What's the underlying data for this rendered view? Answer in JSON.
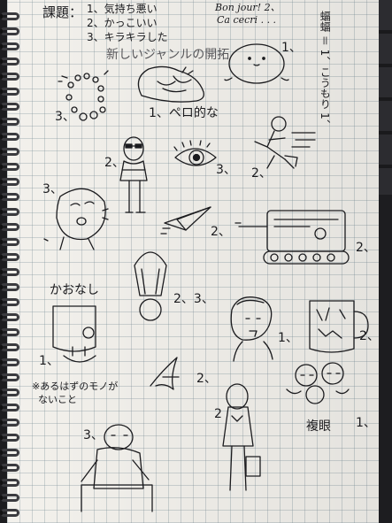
{
  "header": {
    "title_prefix": "課題：",
    "items": [
      "1、気持ち悪い",
      "2、かっこいい",
      "3、キラキラした"
    ],
    "genre": "新しいジャンルの開拓"
  },
  "french": {
    "line1": "Bon jour! 2、",
    "line2": "Ca cecri . . ."
  },
  "vertical_note": "蝠蝠 ＝ 1、こうもり 1、",
  "labels": {
    "head": "1、",
    "pero": "1、ペロ的な",
    "rings": "3、",
    "sun": "2、",
    "eye": "3、",
    "eye_after": "2、",
    "shout": "3、",
    "plane": "2、",
    "truck": "2、",
    "face_none": "かおなし",
    "face_none_num": "1、",
    "note": "※あるはずのモノが\n  ないこと",
    "medal": "2、3、",
    "boy": "1、",
    "script": "2、",
    "woman": "2",
    "sofa": "3、",
    "mug": "2、",
    "sleep_num": "1、",
    "sleep": "複眼"
  },
  "colors": {
    "ink": "#1b1b1e",
    "paper": "#f3f1ec",
    "grid": "#788c96",
    "background": "#1d1d20"
  }
}
